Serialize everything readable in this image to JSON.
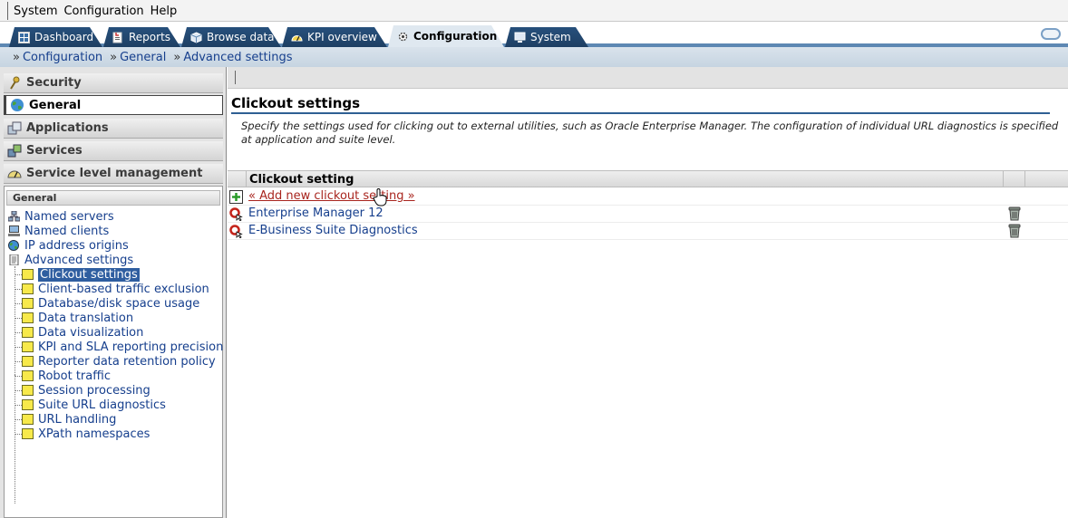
{
  "menubar": {
    "items": [
      "System",
      "Configuration",
      "Help"
    ]
  },
  "tabs": [
    {
      "label": "Dashboard",
      "icon": "dashboard-icon"
    },
    {
      "label": "Reports",
      "icon": "reports-icon"
    },
    {
      "label": "Browse data",
      "icon": "cube-icon"
    },
    {
      "label": "KPI overview",
      "icon": "gauge-icon"
    },
    {
      "label": "Configuration",
      "icon": "gear-icon",
      "active": true
    },
    {
      "label": "System",
      "icon": "monitor-icon"
    }
  ],
  "breadcrumb": [
    "Configuration",
    "General",
    "Advanced settings"
  ],
  "breadcrumb_sep": "»",
  "accordion": [
    {
      "label": "Security",
      "icon": "key-icon"
    },
    {
      "label": "General",
      "icon": "globe-icon",
      "active": true
    },
    {
      "label": "Applications",
      "icon": "applications-icon"
    },
    {
      "label": "Services",
      "icon": "services-icon"
    },
    {
      "label": "Service level management",
      "icon": "gauge-icon"
    }
  ],
  "tree": {
    "header": "General",
    "top_items": [
      {
        "label": "Named servers",
        "icon": "network-icon"
      },
      {
        "label": "Named clients",
        "icon": "computer-icon"
      },
      {
        "label": "IP address origins",
        "icon": "globe-icon"
      },
      {
        "label": "Advanced settings",
        "icon": "document-icon"
      }
    ],
    "children": [
      {
        "label": "Clickout settings",
        "selected": true
      },
      {
        "label": "Client-based traffic exclusion"
      },
      {
        "label": "Database/disk space usage"
      },
      {
        "label": "Data translation"
      },
      {
        "label": "Data visualization"
      },
      {
        "label": "KPI and SLA reporting precision"
      },
      {
        "label": "Reporter data retention policy"
      },
      {
        "label": "Robot traffic"
      },
      {
        "label": "Session processing"
      },
      {
        "label": "Suite URL diagnostics"
      },
      {
        "label": "URL handling"
      },
      {
        "label": "XPath namespaces"
      }
    ]
  },
  "content": {
    "title": "Clickout settings",
    "description": "Specify the settings used for clicking out to external utilities, such as Oracle Enterprise Manager. The configuration of individual URL diagnostics is specified at application and suite level.",
    "column_header": "Clickout setting",
    "add_link": "« Add new clickout setting »",
    "rows": [
      {
        "label": "Enterprise Manager 12"
      },
      {
        "label": "E-Business Suite Diagnostics"
      }
    ]
  },
  "colors": {
    "tab_bg": "#27507c",
    "tab_underline": "#5d88b3",
    "link": "#163f8d",
    "add_link": "#a8251e",
    "selection": "#2f5ea0"
  }
}
